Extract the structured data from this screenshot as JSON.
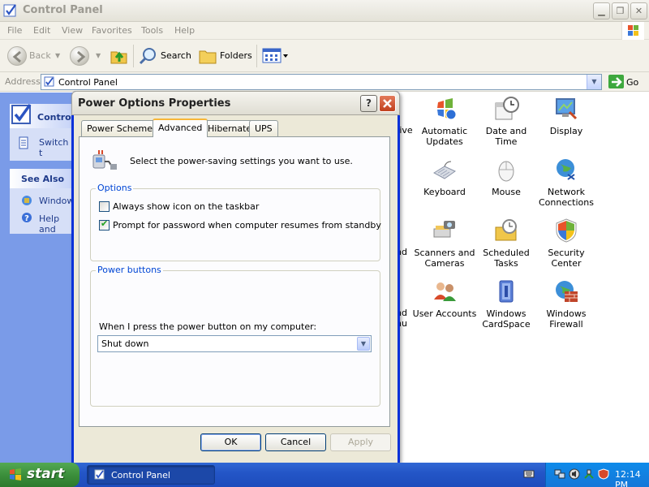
{
  "window": {
    "title": "Control Panel",
    "menu": [
      "File",
      "Edit",
      "View",
      "Favorites",
      "Tools",
      "Help"
    ],
    "toolbar": {
      "back": "Back",
      "search": "Search",
      "folders": "Folders"
    },
    "address": {
      "label": "Address",
      "value": "Control Panel",
      "go": "Go"
    }
  },
  "sidebar": {
    "panel_title": "Control",
    "switch_text": "Switch t",
    "see_also": "See Also",
    "links": [
      "Windows",
      "Help and"
    ]
  },
  "content": {
    "fragments": [
      "tive",
      "t",
      "nd",
      "nd",
      "nu"
    ],
    "items": [
      {
        "label": "Automatic Updates",
        "icon": "automatic-updates-icon"
      },
      {
        "label": "Date and Time",
        "icon": "date-time-icon"
      },
      {
        "label": "Display",
        "icon": "display-icon"
      },
      {
        "label": "Keyboard",
        "icon": "keyboard-icon"
      },
      {
        "label": "Mouse",
        "icon": "mouse-icon"
      },
      {
        "label": "Network Connections",
        "icon": "network-connections-icon"
      },
      {
        "label": "Scanners and Cameras",
        "icon": "scanners-cameras-icon"
      },
      {
        "label": "Scheduled Tasks",
        "icon": "scheduled-tasks-icon"
      },
      {
        "label": "Security Center",
        "icon": "security-center-icon"
      },
      {
        "label": "User Accounts",
        "icon": "user-accounts-icon"
      },
      {
        "label": "Windows CardSpace",
        "icon": "cardspace-icon"
      },
      {
        "label": "Windows Firewall",
        "icon": "firewall-icon"
      }
    ]
  },
  "dialog": {
    "title": "Power Options Properties",
    "help_button": "?",
    "tabs": [
      "Power Schemes",
      "Advanced",
      "Hibernate",
      "UPS"
    ],
    "active_tab": "Advanced",
    "intro": "Select the power-saving settings you want to use.",
    "options_group": "Options",
    "checkboxes": [
      {
        "label": "Always show icon on the taskbar",
        "checked": false
      },
      {
        "label": "Prompt for password when computer resumes from standby",
        "checked": true
      }
    ],
    "power_buttons_group": "Power buttons",
    "power_button_label": "When I press the power button on my computer:",
    "power_button_value": "Shut down",
    "buttons": {
      "ok": "OK",
      "cancel": "Cancel",
      "apply": "Apply"
    }
  },
  "taskbar": {
    "start": "start",
    "task": "Control Panel",
    "clock": "12:14 PM"
  },
  "colors": {
    "xp_blue": "#0831d9",
    "dialog_face": "#ece9d8",
    "taskbar_blue": "#2456c7",
    "start_green": "#3c8f3c",
    "tab_highlight": "#f7b638",
    "groupbox_label": "#0046d5"
  }
}
